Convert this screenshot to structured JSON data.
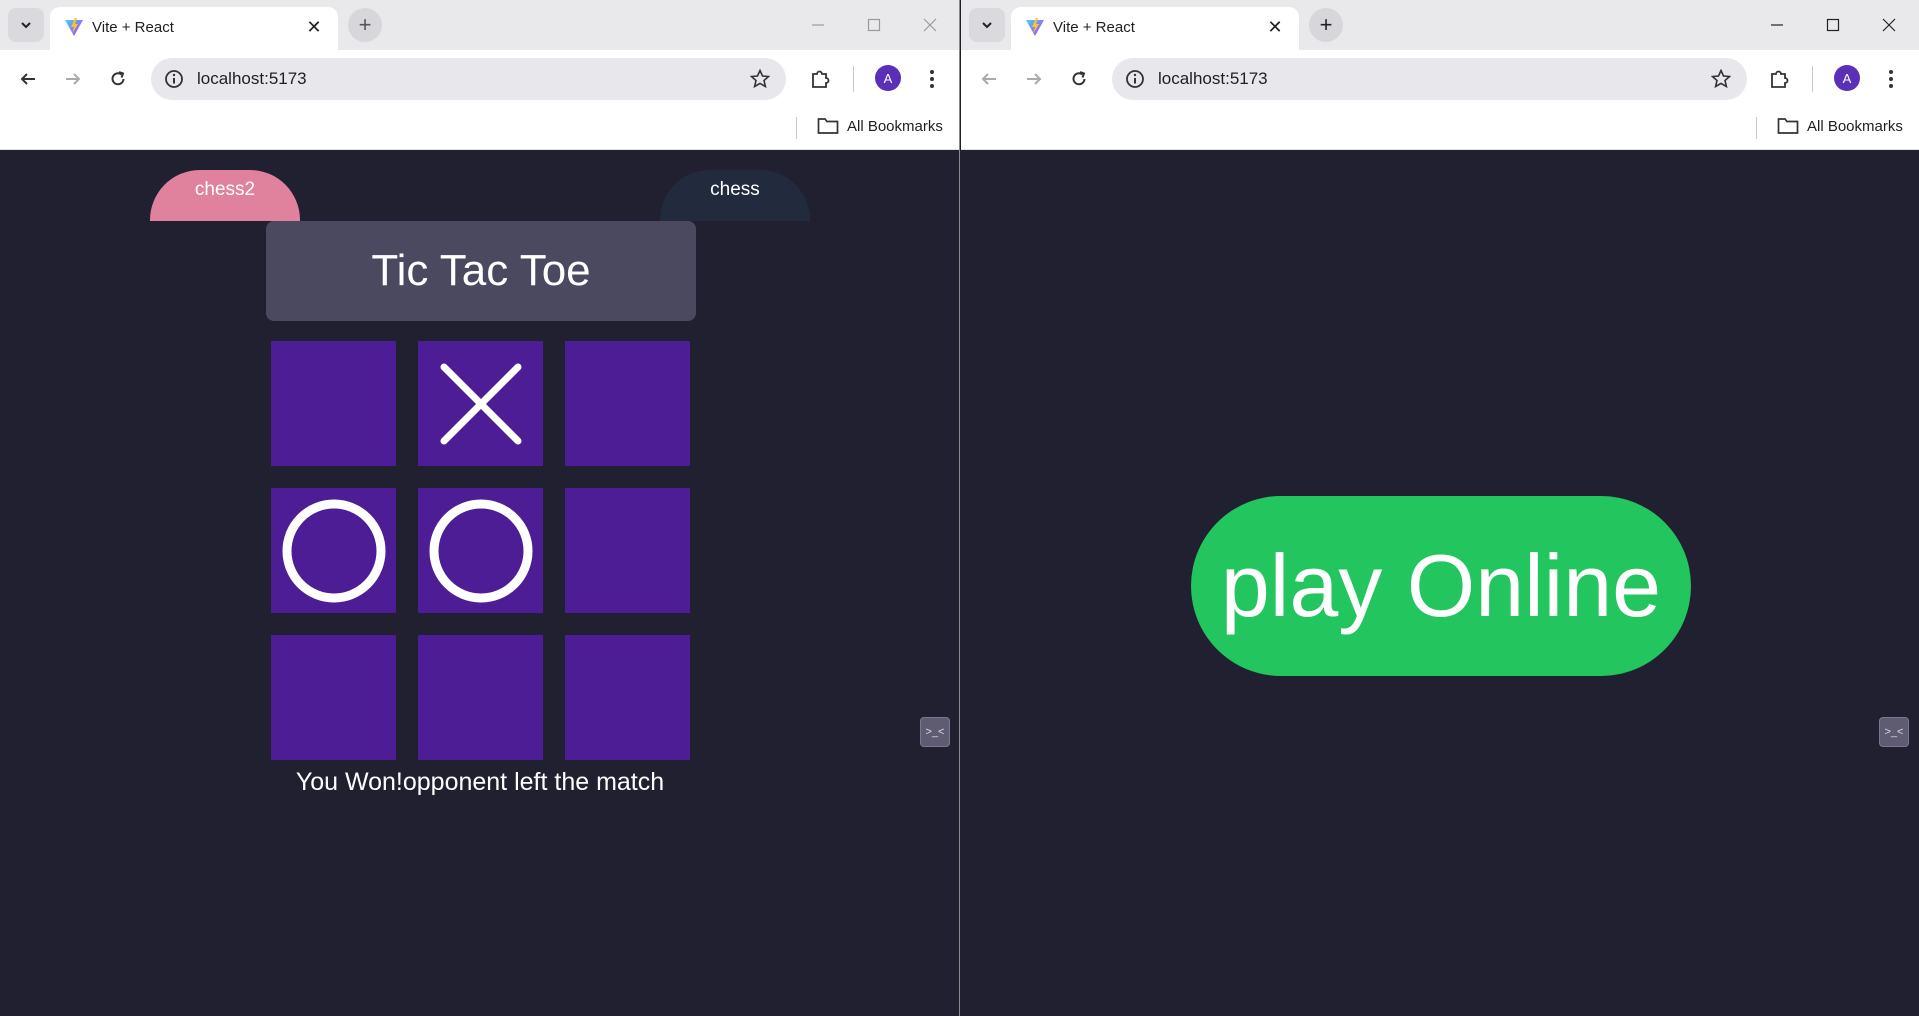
{
  "left_window": {
    "tab": {
      "title": "Vite + React"
    },
    "address": {
      "url": "localhost:5173"
    },
    "profile": {
      "initial": "A"
    },
    "bookmarks": {
      "all_label": "All Bookmarks"
    },
    "page": {
      "nav": {
        "chess2_label": "chess2",
        "chess_label": "chess"
      },
      "title": "Tic Tac Toe",
      "board": [
        "",
        "X",
        "",
        "O",
        "O",
        "",
        "",
        "",
        ""
      ],
      "status": "You Won!opponent left the match"
    }
  },
  "right_window": {
    "tab": {
      "title": "Vite + React"
    },
    "address": {
      "url": "localhost:5173"
    },
    "profile": {
      "initial": "A"
    },
    "bookmarks": {
      "all_label": "All Bookmarks"
    },
    "page": {
      "play_button_label": "play Online"
    }
  },
  "colors": {
    "page_background": "#202030",
    "cell": "#4c1d95",
    "title_box": "#4a4960",
    "chess2_pill": "#e0829e",
    "chess_pill": "#222b3d",
    "play_button": "#22c55e",
    "profile_avatar": "#5b2fb8"
  },
  "icons": {
    "tab_search": "chevron-down-icon",
    "favicon": "vite-logo-icon",
    "new_tab": "plus-icon",
    "back": "arrow-left-icon",
    "forward": "arrow-right-icon",
    "reload": "reload-icon",
    "site_info": "info-icon",
    "bookmark_star": "star-icon",
    "extensions": "puzzle-icon",
    "menu": "kebab-menu-icon",
    "bookmarks_folder": "folder-icon",
    "window_minimize": "minimize-icon",
    "window_maximize": "maximize-icon",
    "window_close": "close-icon"
  }
}
